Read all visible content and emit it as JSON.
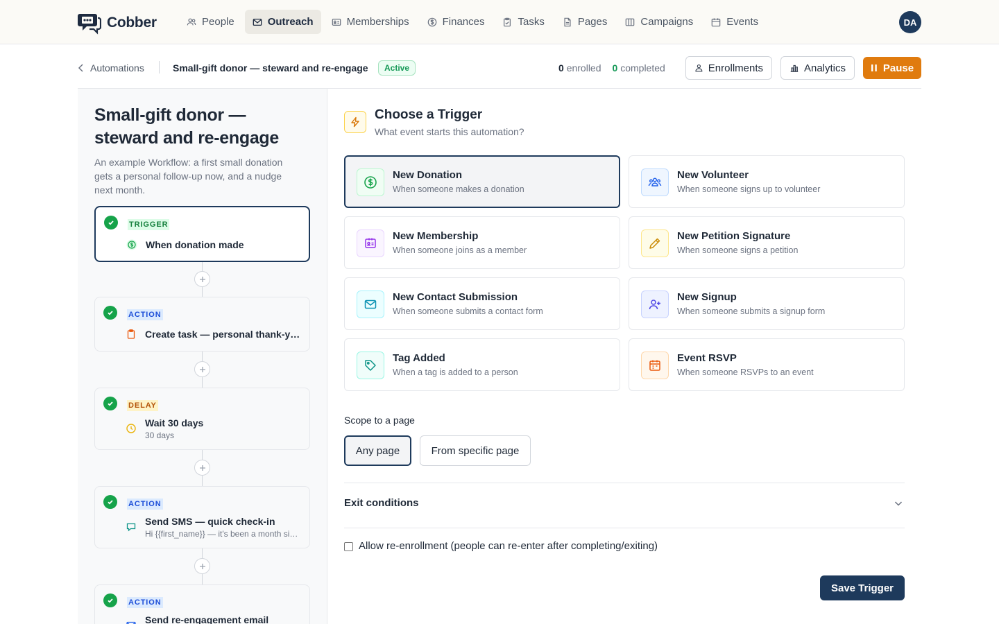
{
  "app": {
    "name": "Cobber",
    "logo_icon": "chat-bubbles-icon"
  },
  "nav": {
    "items": [
      {
        "label": "People",
        "icon": "people-icon",
        "active": false
      },
      {
        "label": "Outreach",
        "icon": "mail-icon",
        "active": true
      },
      {
        "label": "Memberships",
        "icon": "id-card-icon",
        "active": false
      },
      {
        "label": "Finances",
        "icon": "dollar-icon",
        "active": false
      },
      {
        "label": "Tasks",
        "icon": "clipboard-icon",
        "active": false
      },
      {
        "label": "Pages",
        "icon": "document-icon",
        "active": false
      },
      {
        "label": "Campaigns",
        "icon": "columns-icon",
        "active": false
      },
      {
        "label": "Events",
        "icon": "calendar-icon",
        "active": false
      }
    ],
    "avatar_initials": "DA"
  },
  "header": {
    "back_label": "Automations",
    "title": "Small-gift donor — steward and re-engage",
    "status": "Active",
    "enrolled_count": "0",
    "enrolled_label": "enrolled",
    "completed_count": "0",
    "completed_label": "completed",
    "enrollments_label": "Enrollments",
    "analytics_label": "Analytics",
    "pause_label": "Pause"
  },
  "workflow": {
    "title": "Small-gift donor — steward and re-engage",
    "description": "An example Workflow: a first small donation gets a personal follow-up now, and a nudge next month.",
    "steps": [
      {
        "tag": "TRIGGER",
        "label": "When donation made",
        "sub": "",
        "icon": "dollar-icon"
      },
      {
        "tag": "ACTION",
        "label": "Create task — personal thank-you call",
        "sub": "",
        "icon": "clipboard-icon"
      },
      {
        "tag": "DELAY",
        "label": "Wait 30 days",
        "sub": "30 days",
        "icon": "clock-icon"
      },
      {
        "tag": "ACTION",
        "label": "Send SMS — quick check-in",
        "sub": "Hi {{first_name}} — it's been a month since your gift",
        "icon": "chat-icon"
      },
      {
        "tag": "ACTION",
        "label": "Send re-engagement email",
        "sub": "",
        "icon": "mail-icon"
      }
    ]
  },
  "trigger_panel": {
    "title": "Choose a Trigger",
    "subtitle": "What event starts this automation?",
    "icon": "lightning-icon",
    "options": [
      {
        "title": "New Donation",
        "desc": "When someone makes a donation",
        "icon": "dollar-icon",
        "color": "#16a34a",
        "selected": true
      },
      {
        "title": "New Volunteer",
        "desc": "When someone signs up to volunteer",
        "icon": "people-icon",
        "color": "#2563eb",
        "selected": false
      },
      {
        "title": "New Membership",
        "desc": "When someone joins as a member",
        "icon": "id-card-icon",
        "color": "#9333ea",
        "selected": false
      },
      {
        "title": "New Petition Signature",
        "desc": "When someone signs a petition",
        "icon": "pencil-icon",
        "color": "#ca8a04",
        "selected": false
      },
      {
        "title": "New Contact Submission",
        "desc": "When someone submits a contact form",
        "icon": "mail-icon",
        "color": "#0891b2",
        "selected": false
      },
      {
        "title": "New Signup",
        "desc": "When someone submits a signup form",
        "icon": "user-plus-icon",
        "color": "#4f46e5",
        "selected": false
      },
      {
        "title": "Tag Added",
        "desc": "When a tag is added to a person",
        "icon": "tag-icon",
        "color": "#0d9488",
        "selected": false
      },
      {
        "title": "Event RSVP",
        "desc": "When someone RSVPs to an event",
        "icon": "calendar-icon",
        "color": "#ea580c",
        "selected": false
      }
    ],
    "scope_label": "Scope to a page",
    "scope_options": [
      {
        "label": "Any page",
        "selected": true
      },
      {
        "label": "From specific page",
        "selected": false
      }
    ],
    "exit_conditions_label": "Exit conditions",
    "reenroll_label": "Allow re-enrollment (people can re-enter after completing/exiting)",
    "reenroll_checked": false,
    "save_label": "Save Trigger"
  }
}
